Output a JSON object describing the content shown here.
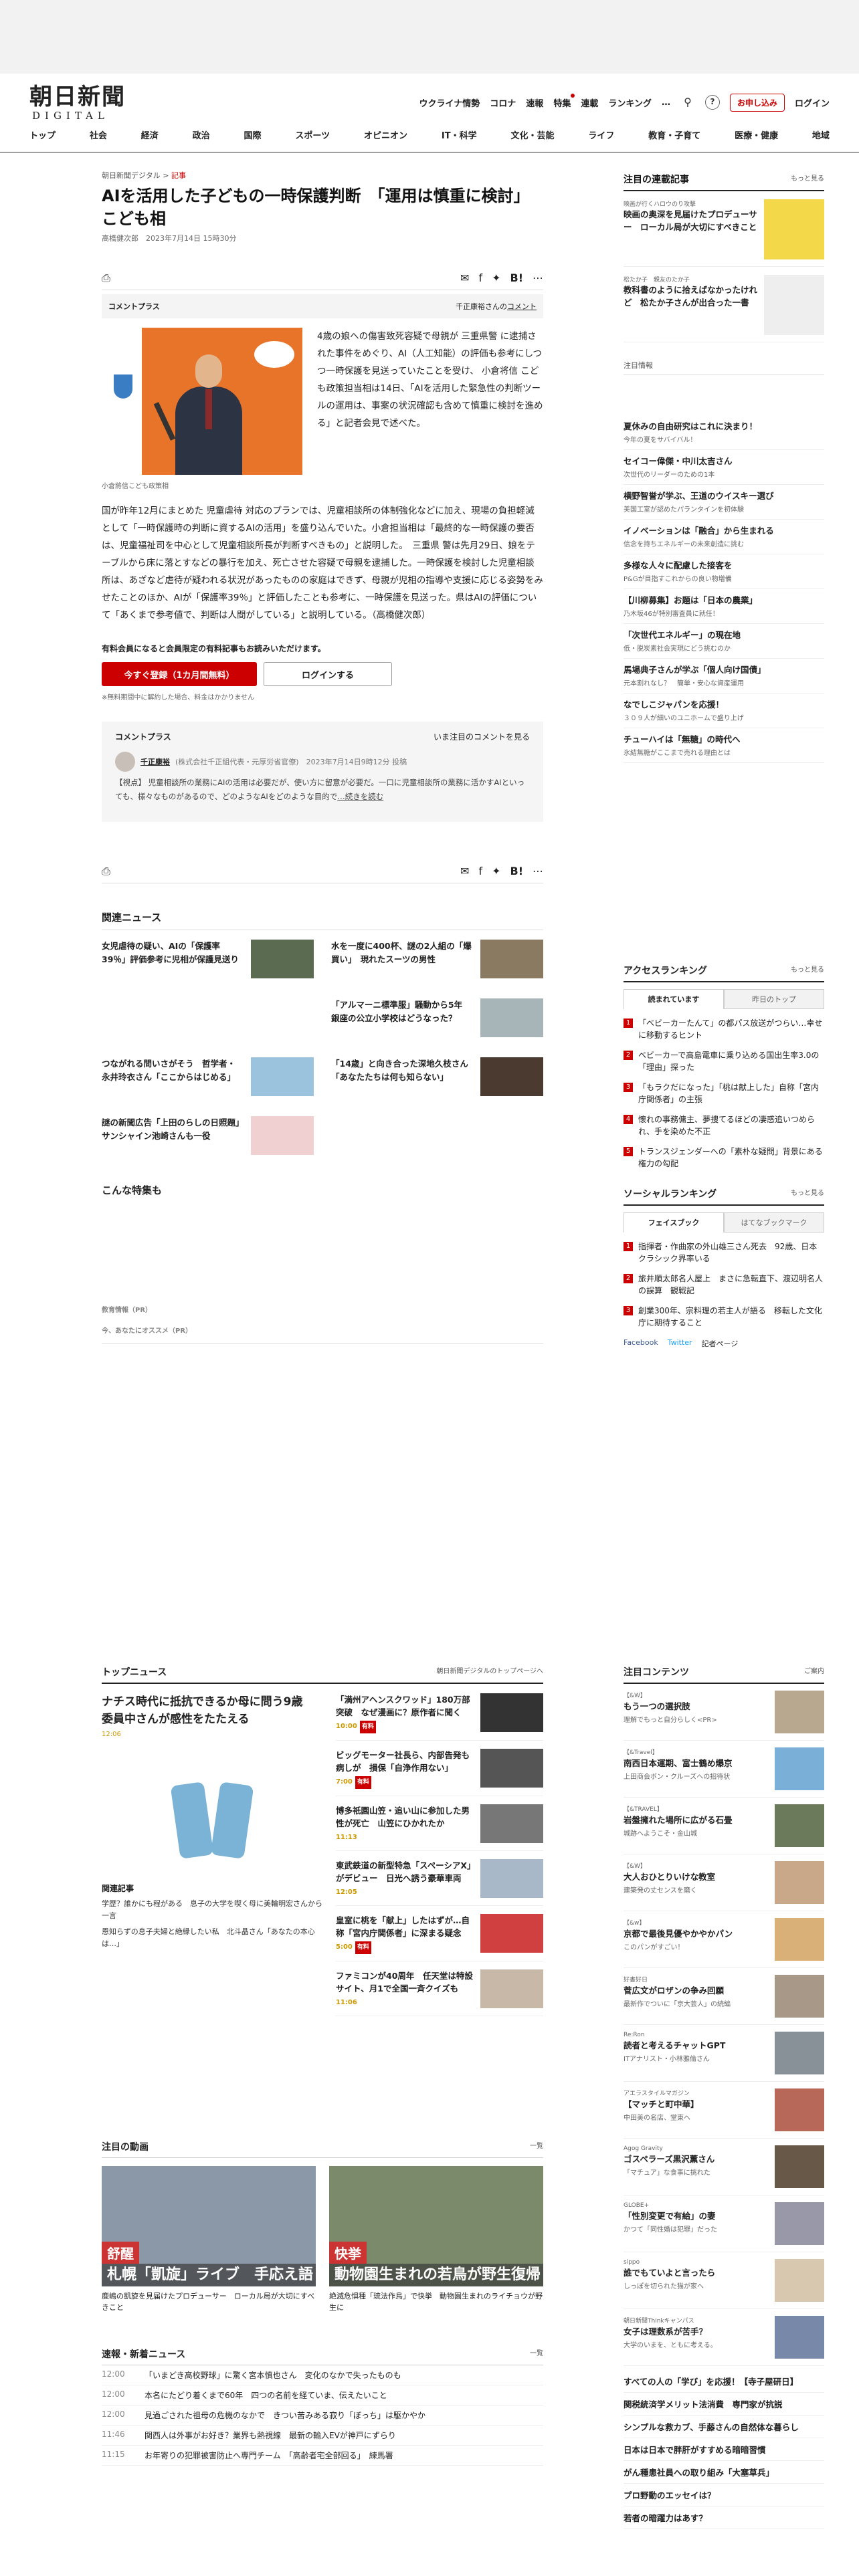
{
  "header": {
    "logo_main": "朝日新聞",
    "logo_sub": "DIGITAL",
    "topnav": [
      "ウクライナ情勢",
      "コロナ",
      "速報",
      "特集",
      "連載",
      "ランキング",
      "…"
    ],
    "subscribe": "お申し込み",
    "login": "ログイン",
    "mainnav": [
      "トップ",
      "社会",
      "経済",
      "政治",
      "国際",
      "スポーツ",
      "オピニオン",
      "IT・科学",
      "文化・芸能",
      "ライフ",
      "教育・子育て",
      "医療・健康",
      "地域"
    ]
  },
  "article": {
    "crumb_site": "朝日新聞デジタル",
    "crumb_sep": ">",
    "crumb_cat": "記事",
    "title": "AIを活用した子どもの一時保護判断　「運用は慎重に検討」こども相",
    "byline": "高橋健次郎　2023年7月14日 15時30分",
    "share_list": "list",
    "share_count": "0",
    "comment_plus": "コメントプラス",
    "comment_by": "千正康裕さんの",
    "comment_link": "コメント",
    "photo_caption": "小倉將信こども政策相",
    "p1": "4歳の娘への傷害致死容疑で母親が 三重県警 に逮捕された事件をめぐり、AI（人工知能）の評価も参考にしつつ一時保護を見送っていたことを受け、 小倉将信 こども政策担当相は14日、「AIを活用した緊急性の判断ツールの運用は、事案の状況確認も含めて慎重に検討を進める」と記者会見で述べた。",
    "p2": "国が昨年12月にまとめた 児童虐待 対応のプランでは、児童相談所の体制強化などに加え、現場の負担軽減として「一時保護時の判断に資するAIの活用」を盛り込んでいた。小倉担当相は「最終的な一時保護の要否は、児童福祉司を中心として児童相談所長が判断すべきもの」と説明した。　三重県 警は先月29日、娘をテーブルから床に落とすなどの暴行を加え、死亡させた容疑で母親を逮捕した。一時保護を検討した児童相談所は、あざなど虐待が疑われる状況があったものの家庭はできず、母親が児相の指導や支援に応じる姿勢をみせたことのほか、AIが「保護率39％」と評価したことも参考に、一時保護を見送った。県はAIの評価について「あくまで参考値で、判断は人間がしている」と説明している。（高橋健次郎）",
    "paywall": "有料会員になると会員限定の有料記事もお読みいただけます。",
    "register_btn": "今すぐ登録（1カ月間無料）",
    "login_btn": "ログインする",
    "note": "※無料期間中に解約した場合、料金はかかりません",
    "cbox_title": "コメントプラス",
    "cbox_more": "いま注目のコメントを見る",
    "cbox_name": "千正康裕",
    "cbox_affil": "(株式会社千正組代表・元厚労省官僚)　2023年7月14日9時12分 投稿",
    "cbox_text": "【視点】 児童相談所の業務にAIの活用は必要だが、使い方に留意が必要だ。一口に児童相談所の業務に活かすAIといっても、様々なものがあるので、どのようなAIをどのような目的で",
    "cbox_readmore": "…続きを読む"
  },
  "related": {
    "title": "関連ニュース",
    "items": [
      {
        "t": "女児虐待の疑い、AIの「保護率39％」評価参考に児相が保護見送り"
      },
      {
        "t": "水を一度に400杯、謎の2人組の「爆買い」　現れたスーツの男性"
      },
      {
        "t": ""
      },
      {
        "t": "「アルマーニ標準服」騒動から5年　銀座の公立小学校はどうなった？"
      },
      {
        "t": "つながれる問いさがそう　哲学者・永井玲衣さん「ここからはじめる」"
      },
      {
        "t": "「14歳」と向き合った深地久枝さん「あなたたちは何も知らない」"
      },
      {
        "t": "謎の新聞広告「上田のらしの日照題」　サンシャイン池崎さんも一役"
      },
      {
        "t": ""
      }
    ]
  },
  "special": {
    "title": "こんな特集も",
    "pr1": "教育情報（PR）",
    "pr2": "今、あなたにオススメ（PR）"
  },
  "side": {
    "title": "注目の連載記事",
    "more": "もっと見る",
    "items": [
      {
        "k": "映画が行くハロウのり攻撃",
        "t": "映画の奥深を見届けたプロデューサー　ローカル局が大切にすべきこと"
      },
      {
        "k": "松たか子　親友のたか子",
        "t": "教科書のように拾えばなかったけれど　松たか子さんが出合った一書"
      }
    ],
    "attention": "注目情報",
    "picks": [
      {
        "t": "夏休みの自由研究はこれに決まり！",
        "s": "今年の夏をサバイバル！"
      },
      {
        "t": "セイコー偉傑・中川太吉さん",
        "s": "次世代のリーダーのための1本"
      },
      {
        "t": "横野智誉が学ぶ、王道のウイスキー選び",
        "s": "美国工室が認めたパランタインを初体験"
      },
      {
        "t": "イノベーションは「融合」から生まれる",
        "s": "信念を持ちエネルギーの未来創造に挑む"
      },
      {
        "t": "多様な人々に配慮した接客を",
        "s": "P&Gが目指すこれからの良い物増備"
      },
      {
        "t": "【川柳募集】お題は「日本の農業」",
        "s": "乃木坂46が特別審査員に就任！"
      },
      {
        "t": "「次世代エネルギー」の現在地",
        "s": "低・脱炭素社会実現にどう挑むのか"
      },
      {
        "t": "馬場典子さんが学ぶ「個人向け国債」",
        "s": "元本割れなし？　簡単・安心な資産運用"
      },
      {
        "t": "なでしこジャパンを応援！",
        "s": "３０９人が細いのユニホームで盛り上げ"
      },
      {
        "t": "チューハイは「無糖」の時代へ",
        "s": "氷結無糖がここまで売れる理由とは"
      }
    ],
    "access_title": "アクセスランキング",
    "access_more": "もっと見る",
    "tab_on": "読まれています",
    "tab_off": "昨日のトップ",
    "ranks": [
      "「ベビーカーたんて」の都パス放送がつらい…幸せに移動するヒント",
      "ベビーカーで高島電車に乗り込める国出生率3.0の「理由」探った",
      "「もラクだになった」「桃は献上した」自称「宮内庁関係者」の主張",
      "懐れの事務傭主、夢捜てるほどの凄惑追いつめられ、手を染めた不正",
      "トランスジェンダーへの「素朴な疑問」背景にある権力の勾配"
    ],
    "social_title": "ソーシャルランキング",
    "social_more": "もっと見る",
    "s_tab_on": "フェイスブック",
    "s_tab_off": "はてなブックマーク",
    "sranks": [
      "指揮者・作曲家の外山雄三さん死去　92歳、日本クラシック界率いる",
      "旅井順太郎名人屋上　まさに急転直下、渡辺明名人の誤算　観戦記",
      "創業300年、宗料理の若主人が語る　移転した文化庁に期待すること"
    ],
    "share_fb": "Facebook",
    "share_tw": "Twitter",
    "share_page": "記者ページ"
  },
  "topnews": {
    "title": "トップニュース",
    "more": "朝日新聞デジタルのトップページへ",
    "lead": "ナチス時代に抵抗できるか母に問う9歳　委員中さんが感性をたたえる",
    "lead_time": "12:06",
    "rel_title": "関連記事",
    "rel": [
      "学歴？誰かにも程がある　息子の大学を喫く母に美輪明宏さんから一言",
      "恩知らずの息子夫婦と絶縁したい私　北斗晶さん「あなたの本心は…」"
    ],
    "items": [
      {
        "t": "「満州アヘンスクワッド」180万部突破　なぜ漫画に？原作者に聞く",
        "tm": "10:00",
        "b": "有料"
      },
      {
        "t": "ビッグモーター社長ら、内部告発も病しが　損保「自浄作用ない」",
        "tm": "7:00",
        "b": "有料"
      },
      {
        "t": "博多祇園山笠・追い山に参加した男性が死亡　山笠にひかれたか",
        "tm": "11:13",
        "b": ""
      },
      {
        "t": "東武鉄道の新型特急「スペーシアX」がデビュー　日光へ誘う豪華車両",
        "tm": "12:05",
        "b": ""
      },
      {
        "t": "皇室に桃を「献上」したはずが…自称「宮内庁関係者」に深まる疑念",
        "tm": "5:00",
        "b": "有料"
      },
      {
        "t": "ファミコンが40周年　任天堂は特設サイト、月1で全国一斉クイズも",
        "tm": "11:06",
        "b": ""
      }
    ]
  },
  "videos": {
    "title": "注目の動画",
    "more": "一覧",
    "items": [
      {
        "tag": "舒醒",
        "lbl": "札幌「凱旋」ライブ　手応え語る",
        "cap": "鹿嶋の凱旋を見届けたプロデューサー　ローカル局が大切にすべきこと"
      },
      {
        "tag": "快挙",
        "lbl": "動物園生まれの若鳥が野生復帰",
        "cap": "絶滅危惧種「琉法作鳥」で快挙　動物園生まれのライチョウが野生に"
      }
    ]
  },
  "sokuhou": {
    "title": "速報・新着ニュース",
    "more": "一覧",
    "items": [
      {
        "tm": "12:00",
        "t": "「いまどき高校野球」に驚く宮本慎也さん　変化のなかで失ったものも"
      },
      {
        "tm": "12:00",
        "t": "本名にたどり着くまで60年　四つの名前を経ていま、伝えたいこと"
      },
      {
        "tm": "12:00",
        "t": "見過ごされた祖母の危機のなかで　きつい苦みある寂り「ぼっち」は駆かやか"
      },
      {
        "tm": "11:46",
        "t": "関西人は外事がお好き？業界も熱視線　最新の輸入EVが神戸にずらり"
      },
      {
        "tm": "11:15",
        "t": "お年寄りの犯罪被害防止へ専門チーム　「高齢者宅全部回る」　練馬署"
      }
    ]
  },
  "contents": {
    "title": "注目コンテンツ",
    "more": "ご案内",
    "items": [
      {
        "k": "【&W】",
        "t": "もう一つの選択肢",
        "s": "理解でもっと自分らしく<PR>"
      },
      {
        "k": "【&Travel】",
        "t": "南西日本運期、富士鶴め爆京",
        "s": "上田商会ボン・クルーズへの招待状"
      },
      {
        "k": "【&TRAVEL】",
        "t": "岩盤擁れた場所に広がる石畳",
        "s": "城跡へようこそ・金山城"
      },
      {
        "k": "【&W】",
        "t": "大人おひとりいけな教室",
        "s": "建築発の丈センスを磨く"
      },
      {
        "k": "【&w】",
        "t": "京都で最後見優やかやかパン",
        "s": "このパンがすごい！"
      },
      {
        "k": "好書好日",
        "t": "菅広文がロザンの争み回願",
        "s": "最新作でついに「京大芸人」の続編"
      },
      {
        "k": "Re:Ron",
        "t": "読者と考えるチャットGPT",
        "s": "ITアナリスト・小林雅倫さん"
      },
      {
        "k": "アエラスタイルマガジン",
        "t": "【マッチと町中華】",
        "s": "中田美の名店、堂東へ"
      },
      {
        "k": "Agog Gravity",
        "t": "ゴスペラーズ黒沢薫さん",
        "s": "「マチュア」な食事に挑れた"
      },
      {
        "k": "GLOBE+",
        "t": "「性別変更で有給」の妻",
        "s": "かつて「同性婚は犯罪」だった"
      },
      {
        "k": "sippo",
        "t": "誰でもていよと言ったら",
        "s": "しっぽを切られた猫が家へ"
      },
      {
        "k": "朝日新聞Thinkキャンパス",
        "t": "女子は理数系が苦手？",
        "s": "大学のいまを、ともに考える。"
      }
    ],
    "plain": [
      "すべての人の「学び」を応援！【寺子屋研日】",
      "関税統済学メリット法消費　専門家が抗説",
      "シンプルな救カブ、手藤さんの自然体な暮らし",
      "日本は日本で胖肝がすすめる暗暗習慣",
      "がん種患社員への取り組み「大塞草兵」",
      "プロ野動のエッセイは？",
      "若者の暗躍力はあす？"
    ]
  }
}
